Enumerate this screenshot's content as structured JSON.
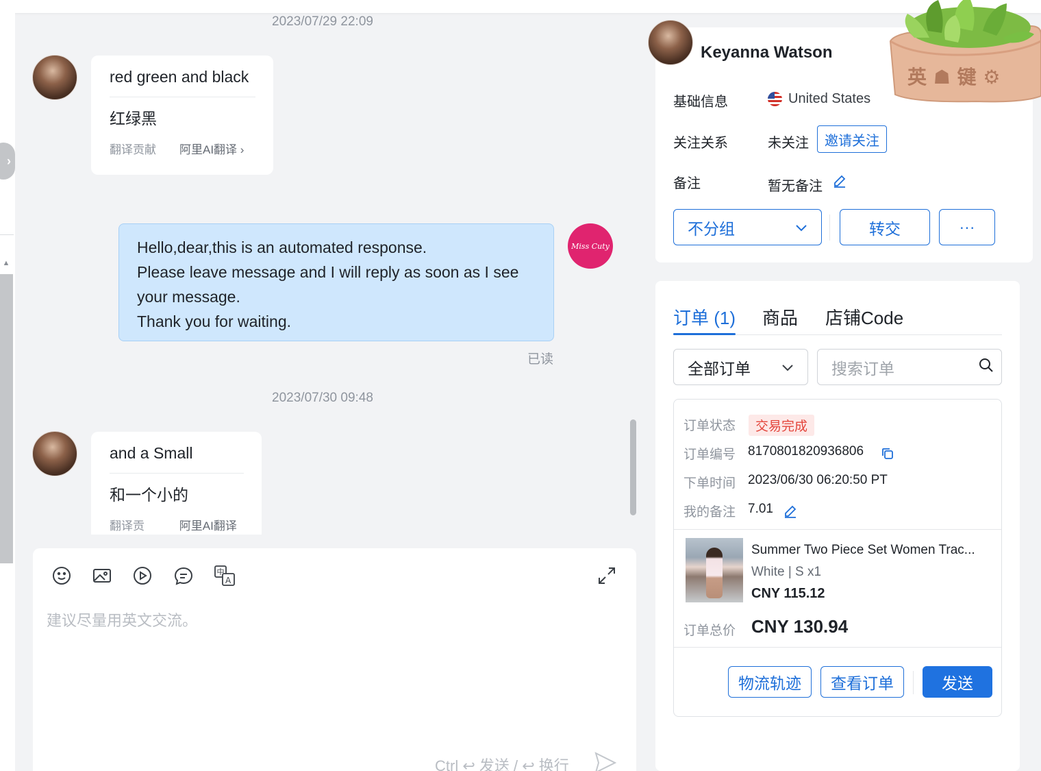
{
  "chat": {
    "messages": [
      {
        "timestamp": "2023/07/29 22:09",
        "original": "red green and black",
        "translation": "红绿黑",
        "contribute": "翻译贡献",
        "ai_translate": "阿里AI翻译"
      },
      {
        "outgoing_lines": [
          "Hello,dear,this is an automated response.",
          "Please leave message and I will reply as soon as I see",
          "your message.",
          "Thank you for waiting."
        ],
        "read_status": "已读",
        "shop_avatar_text": "Miss Cuty"
      },
      {
        "timestamp": "2023/07/30 09:48",
        "original": "and a Small",
        "translation": "和一个小的",
        "contribute": "翻译贡献",
        "ai_translate": "阿里AI翻译"
      }
    ]
  },
  "composer": {
    "placeholder": "建议尽量用英文交流。",
    "send_hint": "Ctrl ↩ 发送 / ↩ 换行",
    "tools": [
      "emoji-icon",
      "image-icon",
      "video-icon",
      "quick-reply-icon",
      "translate-icon"
    ]
  },
  "customer": {
    "name": "Keyanna Watson",
    "basic_info_label": "基础信息",
    "country": "United States",
    "follow_label": "关注关系",
    "follow_status": "未关注",
    "invite_follow": "邀请关注",
    "remark_label": "备注",
    "remark_value": "暂无备注",
    "group_select": "不分组",
    "transfer": "转交",
    "more": "···"
  },
  "overlay": {
    "plant_sign": "英 ☗ 键 ⚙"
  },
  "orders": {
    "tabs": [
      "订单 (1)",
      "商品",
      "店铺Code"
    ],
    "filter": "全部订单",
    "search_placeholder": "搜索订单",
    "card": {
      "status_label": "订单状态",
      "status": "交易完成",
      "number_label": "订单编号",
      "number": "8170801820936806",
      "time_label": "下单时间",
      "time": "2023/06/30 06:20:50 PT",
      "note_label": "我的备注",
      "note": "7.01",
      "product_title": "Summer Two Piece Set Women Trac...",
      "product_spec": "White | S x1",
      "product_price": "CNY 115.12",
      "total_label": "订单总价",
      "total": "CNY 130.94",
      "logistics": "物流轨迹",
      "view_order": "查看订单",
      "send": "发送"
    }
  },
  "colors": {
    "accent": "#1e6fd9",
    "outgoing_bubble": "#cfe7fd",
    "status_red": "#e4463c",
    "shop_avatar": "#e0246f"
  }
}
